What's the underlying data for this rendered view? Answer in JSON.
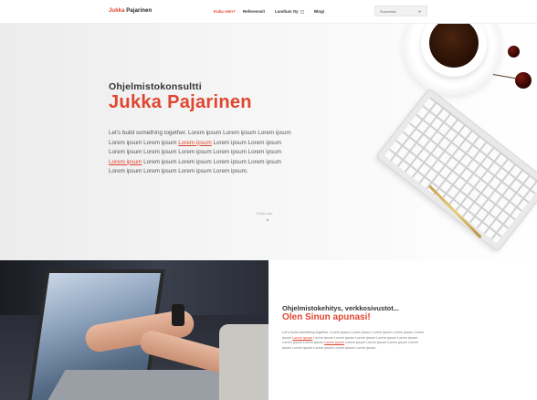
{
  "nav": {
    "brand_first": "Jukka",
    "brand_last": "Pajarinen",
    "items": [
      {
        "label": "Kuka olen?",
        "active": true
      },
      {
        "label": "Referenssit",
        "active": false
      },
      {
        "label": "Lundium Oy",
        "active": false,
        "external": true
      },
      {
        "label": "Blogi",
        "active": false
      }
    ],
    "language_select": {
      "value": "Suomeksi",
      "icon": "chevron-down-icon"
    }
  },
  "hero": {
    "subtitle": "Ohjelmistokonsultti",
    "title": "Jukka Pajarinen",
    "paragraph": [
      {
        "text": "Let's build something together. Lorem ipsum Lorem ipsum Lorem ipsum Lorem ipsum Lorem ipsum ",
        "link": false
      },
      {
        "text": "Lorem ipsum",
        "link": true
      },
      {
        "text": " Lorem ipsum Lorem ipsum Lorem ipsum Lorem ipsum Lorem ipsum Lorem ipsum Lorem ipsum ",
        "link": false
      },
      {
        "text": "Lorem ipsum",
        "link": true
      },
      {
        "text": " Lorem ipsum Lorem ipsum Lorem ipsum Lorem ipsum Lorem ipsum Lorem ipsum Lorem ipsum Lorem ipsum.",
        "link": false
      }
    ],
    "scroll_hint": "Rullaa alas"
  },
  "about": {
    "subtitle": "Ohjelmistokehitys, verkkosivustot...",
    "title": "Olen Sinun apunasi!",
    "paragraph": [
      {
        "text": "Let's build something together. Lorem ipsum Lorem ipsum Lorem ipsum Lorem ipsum Lorem ipsum ",
        "link": false
      },
      {
        "text": "Lorem ipsum",
        "link": true
      },
      {
        "text": " Lorem ipsum Lorem ipsum Lorem ipsum Lorem ipsum Lorem ipsum Lorem ipsum Lorem ipsum ",
        "link": false
      },
      {
        "text": "Lorem ipsum",
        "link": true
      },
      {
        "text": " Lorem ipsum Lorem ipsum Lorem ipsum Lorem ipsum Lorem ipsum Lorem ipsum Lorem ipsum Lorem ipsum.",
        "link": false
      }
    ]
  },
  "colors": {
    "accent": "#e0452f",
    "text": "#333333"
  }
}
